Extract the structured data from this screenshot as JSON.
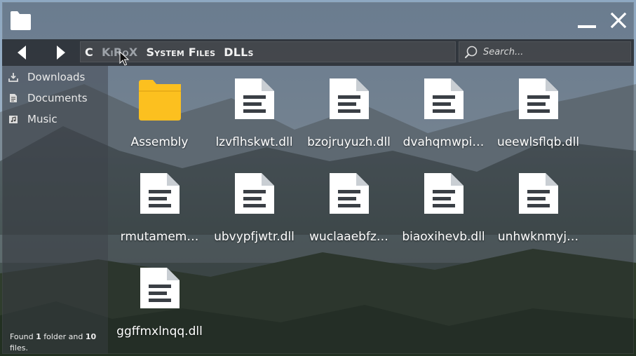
{
  "window": {
    "icon": "folder-icon",
    "minimize_icon": "minimize-icon",
    "close_icon": "close-icon"
  },
  "nav": {
    "back_icon": "back-arrow-icon",
    "forward_icon": "forward-arrow-icon",
    "breadcrumbs": [
      {
        "label": "C"
      },
      {
        "label": "KiRoX"
      },
      {
        "label": "System Files"
      },
      {
        "label": "DLLs"
      }
    ],
    "search": {
      "placeholder": "Search...",
      "value": "",
      "icon": "search-icon"
    }
  },
  "sidebar": {
    "items": [
      {
        "label": "Downloads",
        "icon": "download-icon"
      },
      {
        "label": "Documents",
        "icon": "document-icon"
      },
      {
        "label": "Music",
        "icon": "music-icon"
      }
    ]
  },
  "status": {
    "prefix": "Found",
    "folder_count": "1",
    "middle": "folder and",
    "file_count": "10",
    "suffix": "files."
  },
  "items": [
    {
      "name": "Assembly",
      "type": "folder"
    },
    {
      "name": "lzvflhskwt.dll",
      "type": "file"
    },
    {
      "name": "bzojruyuzh.dll",
      "type": "file"
    },
    {
      "name": "dvahqmwpi…",
      "type": "file"
    },
    {
      "name": "ueewlsflqb.dll",
      "type": "file"
    },
    {
      "name": "rmutamem…",
      "type": "file"
    },
    {
      "name": "ubvypfjwtr.dll",
      "type": "file"
    },
    {
      "name": "wuclaaebfz…",
      "type": "file"
    },
    {
      "name": "biaoxihevb.dll",
      "type": "file"
    },
    {
      "name": "unhwknmyj…",
      "type": "file"
    },
    {
      "name": "ggffmxlnqq.dll",
      "type": "file"
    }
  ],
  "colors": {
    "folder": "#fcc01f",
    "file": "#ffffff",
    "bar": "#2d3137"
  }
}
